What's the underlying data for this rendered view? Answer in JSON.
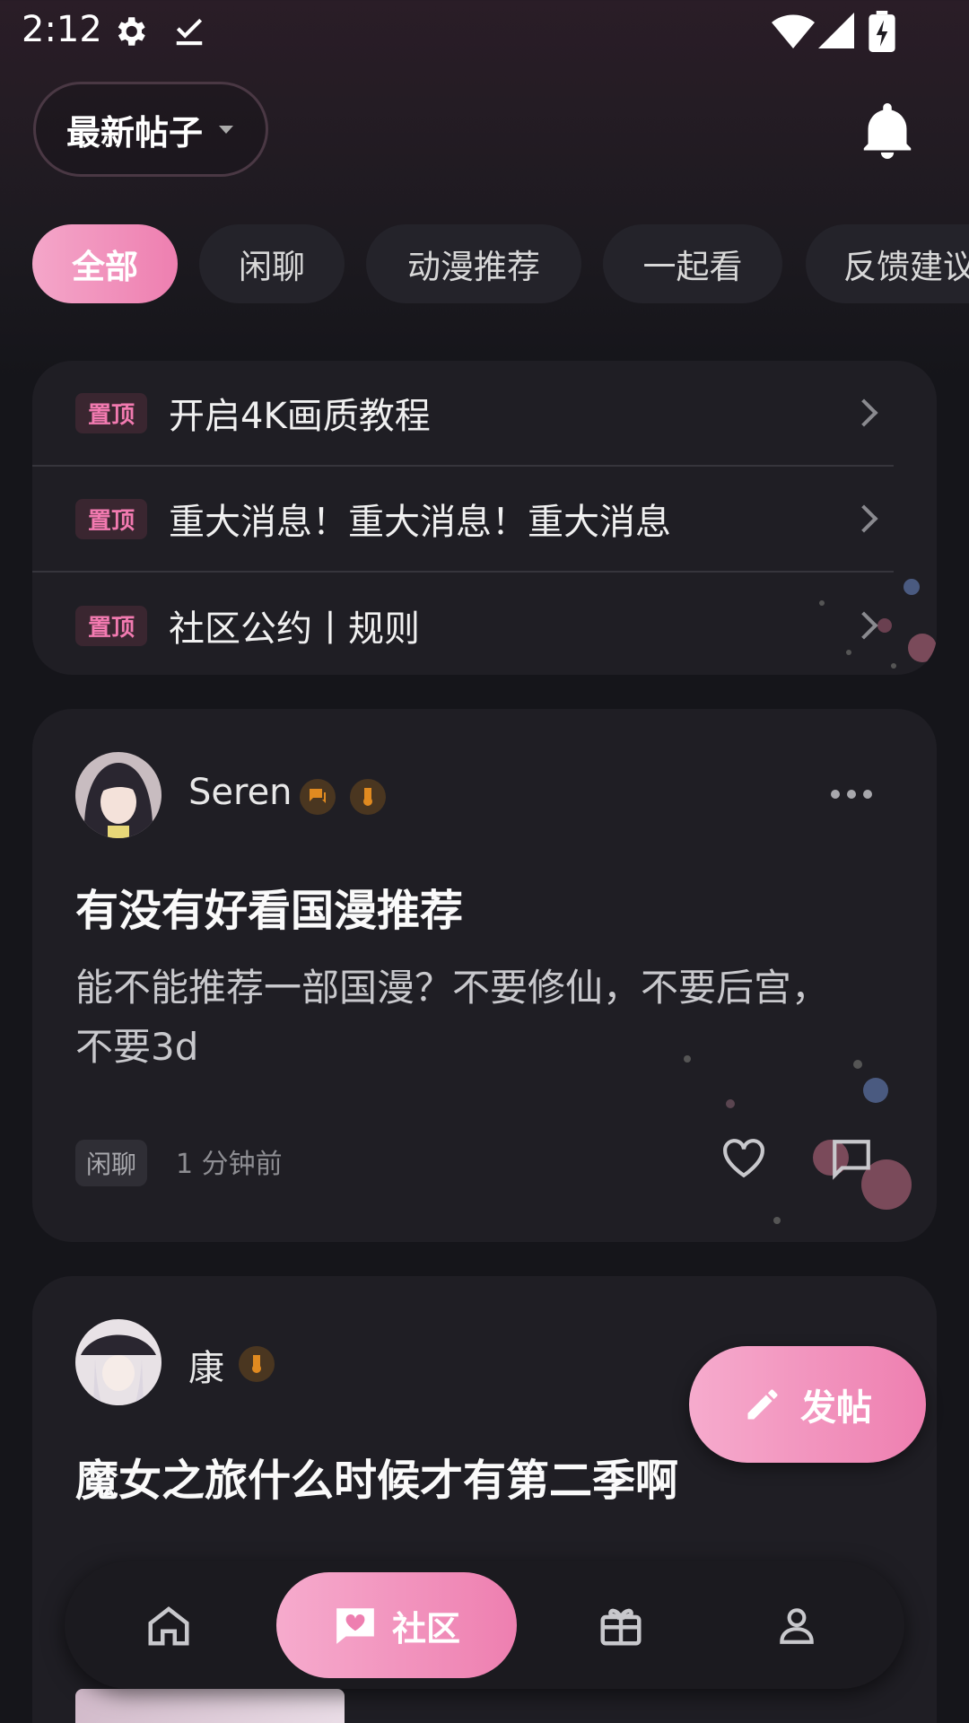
{
  "status_bar": {
    "time": "2:12",
    "icons": [
      "settings-icon",
      "download-done-icon",
      "wifi-icon",
      "signal-icon",
      "battery-charging-icon"
    ]
  },
  "header": {
    "sort_label": "最新帖子",
    "bell_icon": "bell-icon"
  },
  "tabs": [
    {
      "label": "全部",
      "active": true
    },
    {
      "label": "闲聊",
      "active": false
    },
    {
      "label": "动漫推荐",
      "active": false
    },
    {
      "label": "一起看",
      "active": false
    },
    {
      "label": "反馈建议",
      "active": false
    }
  ],
  "pinned": {
    "badge": "置顶",
    "items": [
      {
        "title": "开启4K画质教程"
      },
      {
        "title": "重大消息！重大消息！重大消息"
      },
      {
        "title": "社区公约丨规则"
      }
    ]
  },
  "posts": [
    {
      "author": "Seren",
      "title": "有没有好看国漫推荐",
      "body": "能不能推荐一部国漫？不要修仙，不要后宫，不要3d",
      "tag": "闲聊",
      "time": "1 分钟前"
    },
    {
      "author": "康",
      "title": "魔女之旅什么时候才有第二季啊",
      "body": ""
    }
  ],
  "fab": {
    "label": "发帖"
  },
  "bottom_nav": {
    "items": [
      {
        "name": "home-icon"
      },
      {
        "label": "社区",
        "icon": "chat-heart-icon"
      },
      {
        "name": "gift-icon"
      },
      {
        "name": "profile-icon"
      }
    ]
  },
  "colors": {
    "accent_pink": "#ee7fb0",
    "card_bg": "#1f1e24",
    "badge_pink": "#f27ab0",
    "medal_orange": "#e08a20"
  }
}
